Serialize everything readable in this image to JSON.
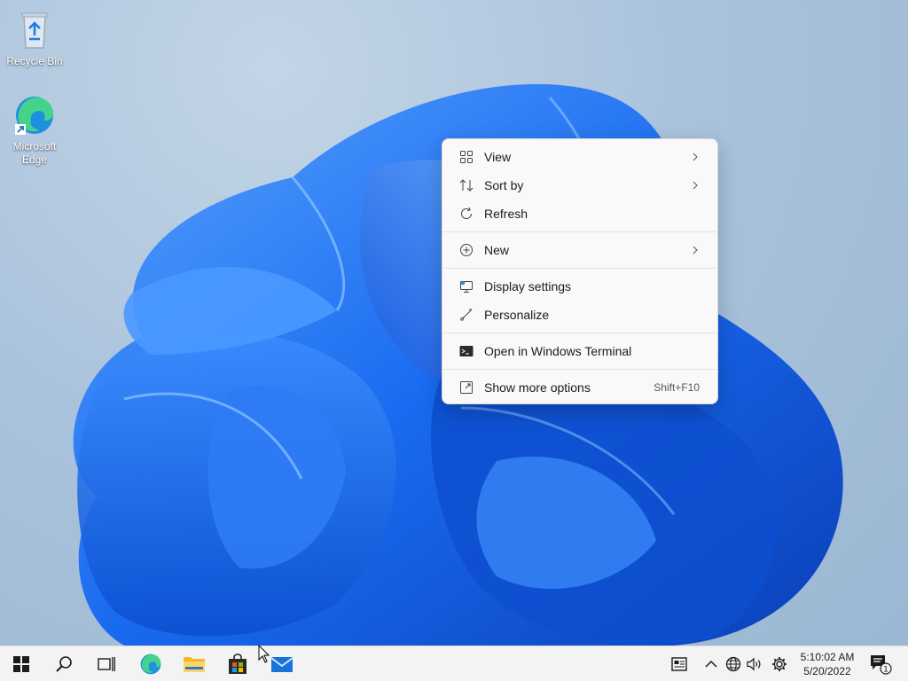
{
  "desktop": {
    "icons": [
      {
        "label": "Recycle Bin"
      },
      {
        "label": "Microsoft Edge"
      }
    ]
  },
  "context_menu": {
    "items": [
      {
        "label": "View",
        "icon": "view-grid-icon",
        "submenu": true
      },
      {
        "label": "Sort by",
        "icon": "sort-icon",
        "submenu": true
      },
      {
        "label": "Refresh",
        "icon": "refresh-icon"
      },
      {
        "label": "New",
        "icon": "new-plus-icon",
        "submenu": true
      },
      {
        "label": "Display settings",
        "icon": "display-settings-icon"
      },
      {
        "label": "Personalize",
        "icon": "personalize-brush-icon"
      },
      {
        "label": "Open in Windows Terminal",
        "icon": "terminal-icon"
      },
      {
        "label": "Show more options",
        "icon": "more-options-icon",
        "shortcut": "Shift+F10"
      }
    ]
  },
  "taskbar": {
    "apps": [
      "start-icon",
      "search-icon",
      "task-view-icon",
      "edge-icon",
      "file-explorer-icon",
      "store-icon",
      "mail-icon"
    ],
    "tray": [
      "news-icon",
      "chevron-up-icon",
      "network-globe-icon",
      "volume-icon",
      "settings-gear-icon"
    ],
    "clock": {
      "time": "5:10:02 AM",
      "date": "5/20/2022"
    },
    "notifications": {
      "count": "1"
    }
  },
  "colors": {
    "accent": "#0a64f5",
    "menu_bg": "#f9f9f9",
    "taskbar_bg": "#f3f3f3"
  }
}
